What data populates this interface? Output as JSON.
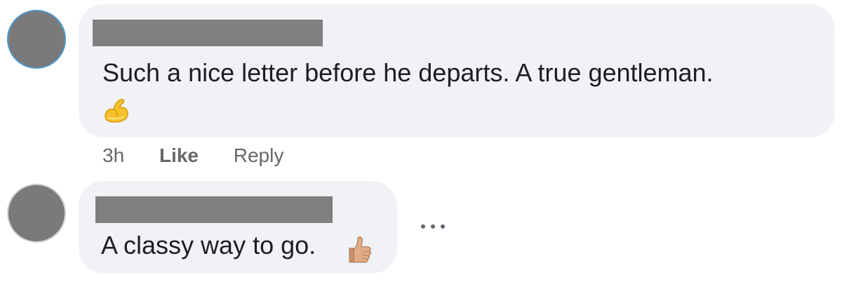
{
  "comments": [
    {
      "author_name": "",
      "text": "Such a nice letter before he departs. A true gentleman.",
      "emoji": "flexed-biceps-icon",
      "timestamp": "3h",
      "like_label": "Like",
      "reply_label": "Reply"
    },
    {
      "author_name": "",
      "text": "A classy way to go.",
      "emoji": "thumbs-up-icon",
      "more_label": "..."
    }
  ],
  "colors": {
    "bubble": "#f0f2f5",
    "text": "#1c1e21",
    "meta": "#65676b",
    "redaction": "#7f7f7f",
    "avatar": "#7a7a7a"
  }
}
